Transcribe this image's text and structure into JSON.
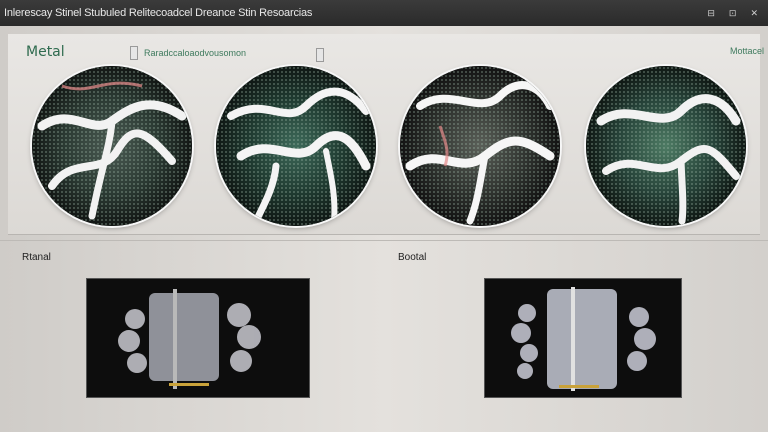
{
  "window": {
    "title": "Inlerescay Stinel Stubuled Relitecoadcel Dreance Stin Resoarcias",
    "controls": [
      "⊟",
      "⊡",
      "✕"
    ]
  },
  "top_panel": {
    "label": "Metal",
    "subtitle": "Raradccaloaodvousomon",
    "right_label": "Mottacel"
  },
  "bottom": {
    "left_label": "Rtanal",
    "right_label": "Bootal"
  },
  "colors": {
    "accent": "#2f6b4f",
    "titlebar": "#2e2e2e"
  }
}
